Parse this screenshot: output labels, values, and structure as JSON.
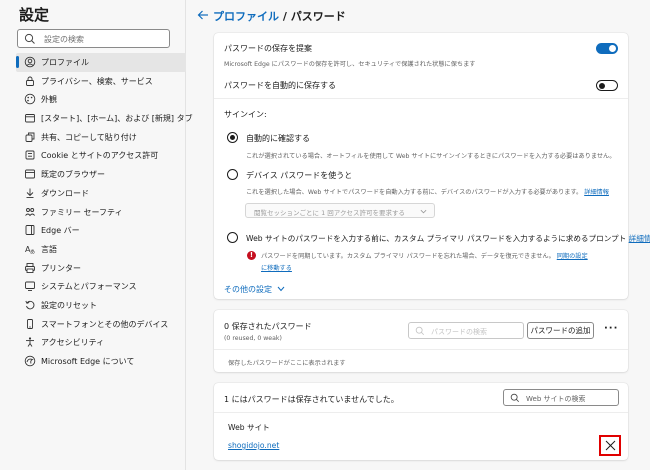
{
  "sidebar": {
    "title": "設定",
    "search_placeholder": "設定の検索",
    "items": [
      {
        "label": "プロファイル",
        "icon": "profile-icon",
        "active": true
      },
      {
        "label": "プライバシー、検索、サービス",
        "icon": "lock-icon"
      },
      {
        "label": "外観",
        "icon": "appearance-icon"
      },
      {
        "label": "[スタート]、[ホーム]、および [新規] タブ",
        "icon": "home-tab-icon"
      },
      {
        "label": "共有、コピーして貼り付け",
        "icon": "share-icon"
      },
      {
        "label": "Cookie とサイトのアクセス許可",
        "icon": "site-permissions-icon"
      },
      {
        "label": "既定のブラウザー",
        "icon": "browser-icon"
      },
      {
        "label": "ダウンロード",
        "icon": "download-icon"
      },
      {
        "label": "ファミリー セーフティ",
        "icon": "family-icon"
      },
      {
        "label": "Edge バー",
        "icon": "edge-bar-icon"
      },
      {
        "label": "言語",
        "icon": "language-icon"
      },
      {
        "label": "プリンター",
        "icon": "printer-icon"
      },
      {
        "label": "システムとパフォーマンス",
        "icon": "system-icon"
      },
      {
        "label": "設定のリセット",
        "icon": "reset-icon"
      },
      {
        "label": "スマートフォンとその他のデバイス",
        "icon": "phone-icon"
      },
      {
        "label": "アクセシビリティ",
        "icon": "accessibility-icon"
      },
      {
        "label": "Microsoft Edge について",
        "icon": "edge-logo-icon"
      }
    ]
  },
  "header": {
    "parent": "プロファイル",
    "separator": "/",
    "current": "パスワード"
  },
  "passwords_card": {
    "offer_save_title": "パスワードの保存を提案",
    "offer_save_desc": "Microsoft Edge にパスワードの保存を許可し、セキュリティで保護された状態に保ちます",
    "auto_save_title": "パスワードを自動的に保存する",
    "signin_label": "サインイン:",
    "option1_title": "自動的に確認する",
    "option1_desc": "これが選択されている場合、オートフィルを使用して Web サイトにサインインするときにパスワードを入力する必要はありません。",
    "option2_title": "デバイス パスワードを使うと",
    "option2_desc": "これを選択した場合、Web サイトでパスワードを自動入力する前に、デバイスのパスワードが入力する必要があります。",
    "option2_link": "詳細情報",
    "dropdown_value": "閲覧セッションごとに 1 回アクセス許可を要求する",
    "option3_title": "Web サイトのパスワードを入力する前に、カスタム プライマリ パスワードを入力するように求めるプロンプト",
    "option3_link": "詳細情報",
    "option3_warn": "パスワードを同期しています。カスタム プライマリ パスワードを忘れた場合、データを復元できません。",
    "option3_warn_link1": "同期の設定",
    "option3_warn_link2": "に移動する",
    "more_settings": "その他の設定",
    "offer_save_on": true,
    "auto_save_on": false
  },
  "saved_card": {
    "title": "0 保存されたパスワード",
    "subtitle": "(0 reused, 0 weak)",
    "search_placeholder": "パスワードの検索",
    "add_button": "パスワードの追加",
    "more": "···",
    "empty_text": "保存したパスワードがここに表示されます"
  },
  "never_card": {
    "title": "1 にはパスワードは保存されていませんでした。",
    "search_placeholder": "Web サイトの検索",
    "column_header": "Web サイト",
    "sites": [
      "shogidojo.net"
    ]
  },
  "colors": {
    "accent": "#0f6cbd",
    "highlight_box": "#e00000",
    "warning": "#c50f1f"
  }
}
